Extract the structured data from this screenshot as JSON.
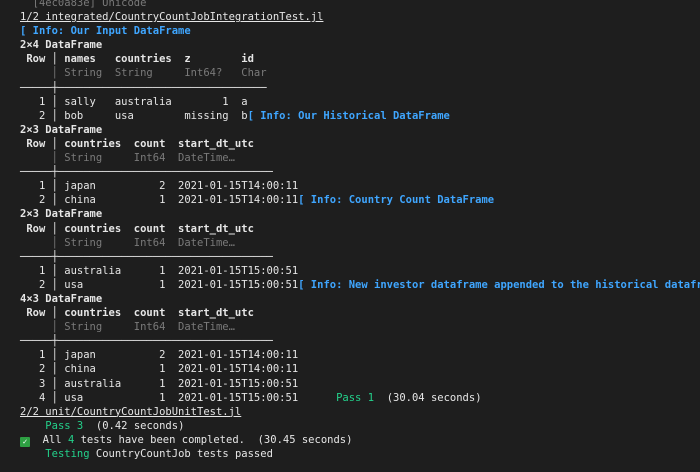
{
  "lines": [
    {
      "text": "  [4ec0a83e] Unicode",
      "style": "dim-white"
    },
    {
      "text": "1/2 integrated/CountryCountJobIntegrationTest.jl",
      "style": "underline"
    },
    {
      "text": "[ Info: Our Input DataFrame",
      "style": "info"
    },
    {
      "text": "2×4 DataFrame",
      "style": "bold"
    },
    {
      "text": " Row │ names   countries  z        id",
      "style": "header"
    },
    {
      "text": "     │ String  String     Int64?   Char",
      "style": "types"
    },
    {
      "text": "─────┼─────────────────────────────────",
      "style": "white"
    },
    {
      "text": "   1 │ sally   australia        1  a",
      "style": "white"
    },
    {
      "text": "   2 │ bob     usa        missing  b",
      "style": "row-missing",
      "suffix": "[ Info: Our Historical DataFrame"
    },
    {
      "text": "2×3 DataFrame",
      "style": "bold"
    },
    {
      "text": " Row │ countries  count  start_dt_utc",
      "style": "header"
    },
    {
      "text": "     │ String     Int64  DateTime…",
      "style": "types"
    },
    {
      "text": "─────┼──────────────────────────────────",
      "style": "white"
    },
    {
      "text": "   1 │ japan          2  2021-01-15T14:00:11",
      "style": "white"
    },
    {
      "text": "   2 │ china          1  2021-01-15T14:00:11",
      "style": "row-info",
      "suffix": "[ Info: Country Count DataFrame"
    },
    {
      "text": "2×3 DataFrame",
      "style": "bold"
    },
    {
      "text": " Row │ countries  count  start_dt_utc",
      "style": "header"
    },
    {
      "text": "     │ String     Int64  DateTime…",
      "style": "types"
    },
    {
      "text": "─────┼──────────────────────────────────",
      "style": "white"
    },
    {
      "text": "   1 │ australia      1  2021-01-15T15:00:51",
      "style": "white"
    },
    {
      "text": "   2 │ usa            1  2021-01-15T15:00:51",
      "style": "row-info",
      "suffix": "[ Info: New investor dataframe appended to the historical dataframe"
    },
    {
      "text": "4×3 DataFrame",
      "style": "bold"
    },
    {
      "text": " Row │ countries  count  start_dt_utc",
      "style": "header"
    },
    {
      "text": "     │ String     Int64  DateTime…",
      "style": "types"
    },
    {
      "text": "─────┼──────────────────────────────────",
      "style": "white"
    },
    {
      "text": "   1 │ japan          2  2021-01-15T14:00:11",
      "style": "white"
    },
    {
      "text": "   2 │ china          1  2021-01-15T14:00:11",
      "style": "white"
    },
    {
      "text": "   3 │ australia      1  2021-01-15T15:00:51",
      "style": "white"
    },
    {
      "text": "   4 │ usa            1  2021-01-15T15:00:51",
      "style": "row-pass",
      "pass_label": "Pass 1",
      "suffix": "(30.04 seconds)"
    },
    {
      "text": "2/2 unit/CountryCountJobUnitTest.jl",
      "style": "underline"
    },
    {
      "text": "",
      "style": "pass",
      "pass_label": "Pass 3",
      "suffix": "(0.42 seconds)"
    },
    {
      "text": "",
      "style": "check",
      "prefix": "All ",
      "count": "4",
      "suffix": " tests have been completed.  (30.45 seconds)"
    },
    {
      "text": "",
      "style": "testing",
      "pass_label": "Testing",
      "suffix": "CountryCountJob tests passed"
    }
  ],
  "icons": {
    "check": "check-square-icon"
  },
  "colors": {
    "background": "#1e1e1e",
    "info": "#3fa6ff",
    "pass": "#23d18b",
    "check": "#2ea043"
  }
}
